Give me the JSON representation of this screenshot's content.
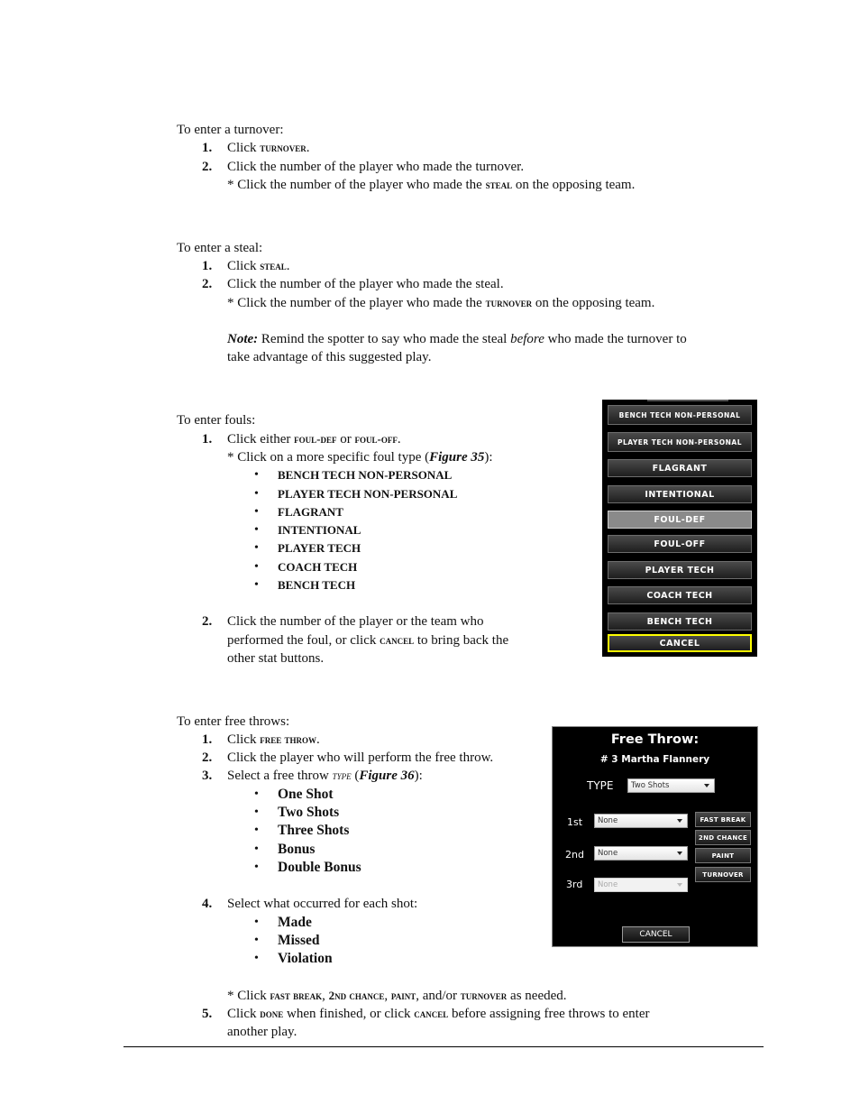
{
  "turnover": {
    "intro": "To enter a turnover:",
    "step1": {
      "num": "1.",
      "pre": "Click ",
      "key": "TURNOVER",
      "post": "."
    },
    "step2": {
      "num": "2.",
      "text": "Click the number of the player who made the turnover."
    },
    "note": {
      "pre": "* Click the number of the player who made the ",
      "key": "STEAL",
      "post": " on the opposing team."
    }
  },
  "steal": {
    "intro": "To enter a steal:",
    "step1": {
      "num": "1.",
      "pre": "Click ",
      "key": "STEAL",
      "post": "."
    },
    "step2": {
      "num": "2.",
      "text": "Click the number of the player who made the steal."
    },
    "note": {
      "pre": "* Click the number of the player who made the ",
      "key": "TURNOVER",
      "post": " on the opposing team."
    },
    "remind": {
      "label": "Note:",
      "pre": " Remind the spotter to say who made the steal ",
      "em": "before",
      "post": " who made the turnover to",
      "line2": "take advantage of this suggested play."
    }
  },
  "fouls": {
    "intro": "To enter fouls:",
    "step1": {
      "num": "1.",
      "pre": "Click either ",
      "key1": "FOUL-DEF",
      "mid": " or ",
      "key2": "FOUL-OFF",
      "post": "."
    },
    "sub": {
      "pre": "* Click on a more specific foul type (",
      "fig": "Figure 35",
      "post": "):"
    },
    "types": [
      "BENCH TECH NON-PERSONAL",
      "PLAYER TECH NON-PERSONAL",
      "FLAGRANT",
      "INTENTIONAL",
      "PLAYER TECH",
      "COACH TECH",
      "BENCH TECH"
    ],
    "step2": {
      "num": "2.",
      "line1": "Click the number of the player or the team who",
      "line2_pre": "performed the foul, or click ",
      "key": "CANCEL",
      "line2_post": " to bring back the",
      "line3": "other stat buttons."
    }
  },
  "foul_panel": {
    "buttons": [
      {
        "label": "BENCH TECH NON-PERSONAL",
        "selected": false
      },
      {
        "label": "PLAYER TECH NON-PERSONAL",
        "selected": false
      },
      {
        "label": "FLAGRANT",
        "selected": false
      },
      {
        "label": "INTENTIONAL",
        "selected": false
      },
      {
        "label": "FOUL-DEF",
        "selected": true
      },
      {
        "label": "FOUL-OFF",
        "selected": false
      },
      {
        "label": "PLAYER TECH",
        "selected": false
      },
      {
        "label": "COACH TECH",
        "selected": false
      },
      {
        "label": "BENCH TECH",
        "selected": false
      }
    ],
    "cancel_label": "CANCEL",
    "cancel_border_color": "#ffff00"
  },
  "free_throws": {
    "intro": "To enter free throws:",
    "step1": {
      "num": "1.",
      "pre": "Click ",
      "key": "FREE THROW",
      "post": "."
    },
    "step2": {
      "num": "2.",
      "text": "Click the player who will perform the free throw."
    },
    "step3": {
      "num": "3.",
      "pre": "Select a free throw ",
      "key": "TYPE",
      "mid": " (",
      "fig": "Figure 36",
      "post": "):"
    },
    "types": [
      "One Shot",
      "Two Shots",
      "Three Shots",
      "Bonus",
      "Double Bonus"
    ],
    "step4": {
      "num": "4.",
      "text": "Select what occurred for each shot:"
    },
    "outcomes": [
      "Made",
      "Missed",
      "Violation"
    ],
    "extra": {
      "pre": "* Click ",
      "k1": "FAST BREAK",
      "s1": ", ",
      "k2": "2ND CHANCE",
      "s2": ", ",
      "k3": "PAINT",
      "s3": ", and/or ",
      "k4": "TURNOVER",
      "post": " as needed."
    },
    "step5": {
      "num": "5.",
      "pre": "Click ",
      "key1": "DONE",
      "mid": " when finished, or click ",
      "key2": "CANCEL",
      "post": " before assigning free throws to enter",
      "line2": "another play."
    }
  },
  "ft_panel": {
    "title": "Free Throw:",
    "player": "# 3 Martha Flannery",
    "type_label": "TYPE",
    "type_value": "Two Shots",
    "shots": [
      {
        "label": "1st",
        "value": "None",
        "enabled": true
      },
      {
        "label": "2nd",
        "value": "None",
        "enabled": true
      },
      {
        "label": "3rd",
        "value": "None",
        "enabled": false
      }
    ],
    "side_buttons": [
      "FAST BREAK",
      "2ND CHANCE",
      "PAINT",
      "TURNOVER"
    ],
    "cancel_label": "CANCEL"
  }
}
